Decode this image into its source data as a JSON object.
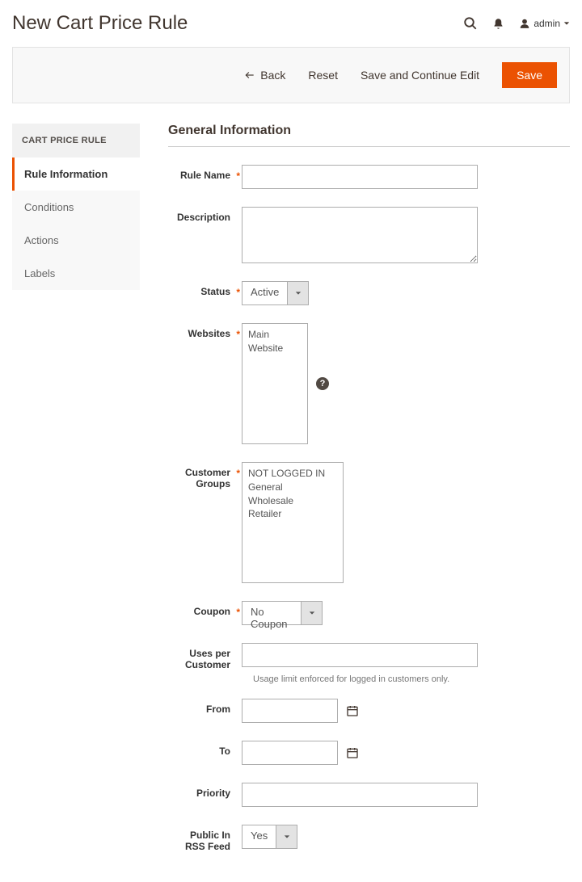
{
  "header": {
    "title": "New Cart Price Rule",
    "user_label": "admin"
  },
  "actions": {
    "back": "Back",
    "reset": "Reset",
    "save_continue": "Save and Continue Edit",
    "save": "Save"
  },
  "sidebar": {
    "heading": "CART PRICE RULE",
    "items": [
      {
        "label": "Rule Information",
        "active": true
      },
      {
        "label": "Conditions",
        "active": false
      },
      {
        "label": "Actions",
        "active": false
      },
      {
        "label": "Labels",
        "active": false
      }
    ]
  },
  "section": {
    "title": "General Information"
  },
  "fields": {
    "rule_name": {
      "label": "Rule Name",
      "value": ""
    },
    "description": {
      "label": "Description",
      "value": ""
    },
    "status": {
      "label": "Status",
      "value": "Active"
    },
    "websites": {
      "label": "Websites",
      "options": [
        "Main Website"
      ]
    },
    "customer_groups": {
      "label": "Customer Groups",
      "options": [
        "NOT LOGGED IN",
        "General",
        "Wholesale",
        "Retailer"
      ]
    },
    "coupon": {
      "label": "Coupon",
      "value": "No Coupon"
    },
    "uses_per_customer": {
      "label": "Uses per Customer",
      "value": "",
      "note": "Usage limit enforced for logged in customers only."
    },
    "from": {
      "label": "From",
      "value": ""
    },
    "to": {
      "label": "To",
      "value": ""
    },
    "priority": {
      "label": "Priority",
      "value": ""
    },
    "rss": {
      "label": "Public In RSS Feed",
      "value": "Yes"
    }
  }
}
